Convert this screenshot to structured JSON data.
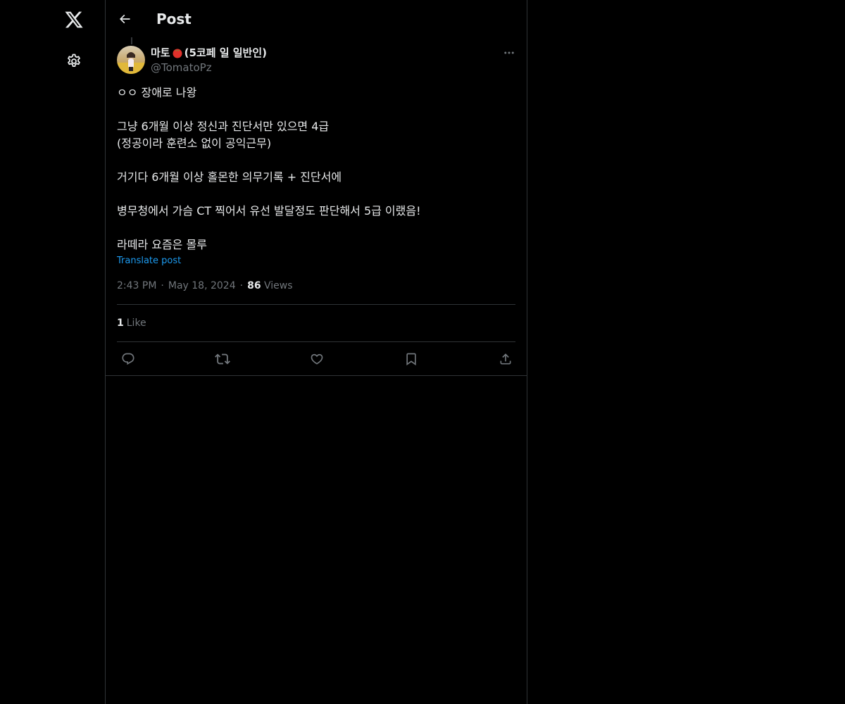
{
  "nav": {
    "logo_icon": "x-logo-icon",
    "settings_icon": "gear-icon"
  },
  "header": {
    "back_icon": "arrow-left-icon",
    "title": "Post"
  },
  "post": {
    "author": {
      "name_before": "마토",
      "name_emoji": "tomato-emoji",
      "name_after": "(5코페 일 일반인)",
      "handle": "@TomatoPz"
    },
    "text_lines": [
      "ㅇㅇ 장애로 나왕",
      "",
      "그냥 6개월 이상 정신과 진단서만 있으면 4급",
      "(정공이라 훈련소 없이 공익근무)",
      "",
      "거기다 6개월 이상 홀몬한 의무기록 + 진단서에",
      "",
      "병무청에서 가슴 CT 찍어서 유선 발달정도 판단해서 5급 이랬음!",
      "",
      "라떼라 요즘은 몰루"
    ],
    "translate_label": "Translate post",
    "time": "2:43 PM",
    "date": "May 18, 2024",
    "separator": "·",
    "views_count": "86",
    "views_label": "Views",
    "likes_count": "1",
    "likes_label": "Like"
  },
  "actions": [
    "reply-icon",
    "retweet-icon",
    "like-icon",
    "bookmark-icon",
    "share-icon"
  ],
  "colors": {
    "background": "#000000",
    "text": "#e7e9ea",
    "secondary": "#71767b",
    "accent": "#1d9bf0",
    "border": "#2f3336"
  }
}
